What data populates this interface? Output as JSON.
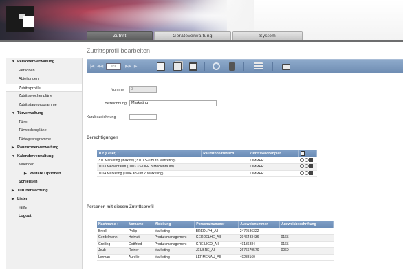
{
  "header": {
    "tabs": [
      {
        "label": "Zutritt",
        "active": true
      },
      {
        "label": "Geräteverwaltung",
        "active": false
      },
      {
        "label": "System",
        "active": false
      }
    ]
  },
  "page": {
    "title": "Zutrittsprofil bearbeiten"
  },
  "toolbar": {
    "page_indicator": "1/1"
  },
  "sidebar": {
    "items": [
      {
        "label": "Personenverwaltung",
        "level": "group",
        "icon": "chevron-down-icon"
      },
      {
        "label": "Personen",
        "level": "sub"
      },
      {
        "label": "Abteilungen",
        "level": "sub"
      },
      {
        "label": "Zutrittsprofile",
        "level": "sub",
        "selected": true
      },
      {
        "label": "Zutrittswochenpläne",
        "level": "sub"
      },
      {
        "label": "Zutrittstageprogramme",
        "level": "sub"
      },
      {
        "label": "Türverwaltung",
        "level": "group",
        "icon": "chevron-down-icon"
      },
      {
        "label": "Türen",
        "level": "sub"
      },
      {
        "label": "Türwochenpläne",
        "level": "sub"
      },
      {
        "label": "Türtageprogramme",
        "level": "sub"
      },
      {
        "label": "Raumzonenverwaltung",
        "level": "group",
        "icon": "chevron-right-icon"
      },
      {
        "label": "Kalenderverwaltung",
        "level": "group",
        "icon": "chevron-down-icon"
      },
      {
        "label": "Kalender",
        "level": "sub"
      },
      {
        "label": "Weitere Optionen",
        "level": "subsub",
        "icon": "chevron-right-icon"
      },
      {
        "label": "Schleusen",
        "level": "plain"
      },
      {
        "label": "Türüberwachung",
        "level": "group",
        "icon": "chevron-right-icon"
      },
      {
        "label": "Listen",
        "level": "group",
        "icon": "chevron-right-icon"
      },
      {
        "label": "Hilfe",
        "level": "plain"
      },
      {
        "label": "Logout",
        "level": "plain"
      }
    ]
  },
  "form": {
    "nummer": {
      "label": "Nummer",
      "value": "3"
    },
    "bezeichnung": {
      "label": "Bezeichnung",
      "value": "Marketing"
    },
    "kurzbezeichnung": {
      "label": "Kurzbezeichnung",
      "value": ""
    }
  },
  "berechtigungen": {
    "title": "Berechtigungen",
    "columns": [
      "Tür (Leser) ↑",
      "Raumzone/Bereich",
      "Zutrittswochenplan"
    ],
    "rows": [
      {
        "tuer": "311 Marketing (Inaktiv!) (311 XS-0 Büro Marketing)",
        "raumzone": "",
        "wochenplan": "1 IMMER"
      },
      {
        "tuer": "1003 Medienraum (1003 XS-OFF B Medienraum)",
        "raumzone": "",
        "wochenplan": "1 IMMER"
      },
      {
        "tuer": "1004 Marketing (1004 XS-Off Z Marketing)",
        "raumzone": "",
        "wochenplan": "1 IMMER"
      }
    ]
  },
  "personen": {
    "title": "Personen mit diesem Zutrittsprofil",
    "columns": [
      "Nachname ↑",
      "Vorname",
      "Abteilung",
      "Personalnummer",
      "Ausweisnummer",
      "Ausweisbeschriftung"
    ],
    "rows": [
      {
        "nachname": "Bredl",
        "vorname": "Philip",
        "abteilung": "Marketing",
        "personalnummer": "BREDLPH_AII",
        "ausweisnummer": "2472586322",
        "beschriftung": ""
      },
      {
        "nachname": "Gerdelmann",
        "vorname": "Helmut",
        "abteilung": "Produktmanagement",
        "personalnummer": "GERDELHE_AII",
        "ausweisnummer": "2946483436",
        "beschriftung": "0165"
      },
      {
        "nachname": "Greiling",
        "vorname": "Gottfried",
        "abteilung": "Produktmanagement",
        "personalnummer": "GREILIGO_AII",
        "ausweisnummer": "49136884",
        "beschriftung": "0165"
      },
      {
        "nachname": "Jeub",
        "vorname": "Reiner",
        "abteilung": "Marketing",
        "personalnummer": "JEUBRE_AII",
        "ausweisnummer": "2676679570",
        "beschriftung": "0060"
      },
      {
        "nachname": "Lerman",
        "vorname": "Aurelie",
        "abteilung": "Marketing",
        "personalnummer": "LERMENAU_AII",
        "ausweisnummer": "49288160",
        "beschriftung": ""
      }
    ]
  },
  "colors": {
    "toolbar": "#7f9dc2",
    "table_header": "#7496c0",
    "header_dark": "#6d6e6f"
  }
}
